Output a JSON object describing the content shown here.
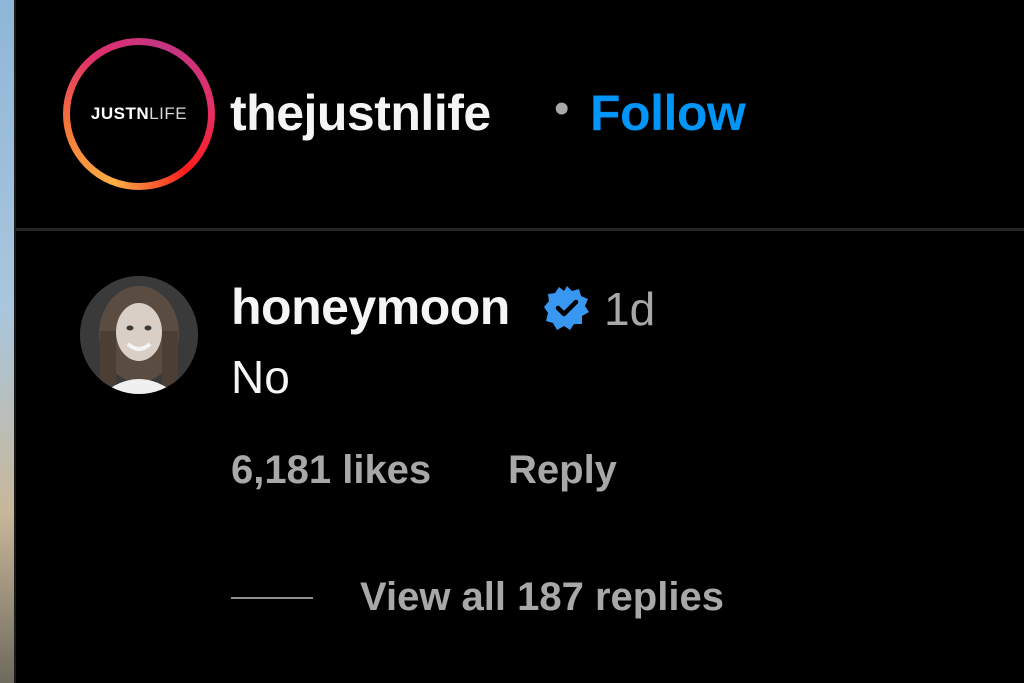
{
  "post_header": {
    "logo_text_bold": "JUSTN",
    "logo_text_thin": "LIFE",
    "username": "thejustnlife",
    "separator": "•",
    "follow_label": "Follow"
  },
  "comment": {
    "username": "honeymoon",
    "verified_icon": "verified-badge-icon",
    "time": "1d",
    "text": "No",
    "likes": "6,181 likes",
    "reply_label": "Reply",
    "view_replies_label": "View all 187 replies"
  },
  "colors": {
    "background": "#000000",
    "accent_blue": "#0095f6",
    "secondary_text": "#a8a8a8",
    "primary_text": "#f5f5f5"
  }
}
